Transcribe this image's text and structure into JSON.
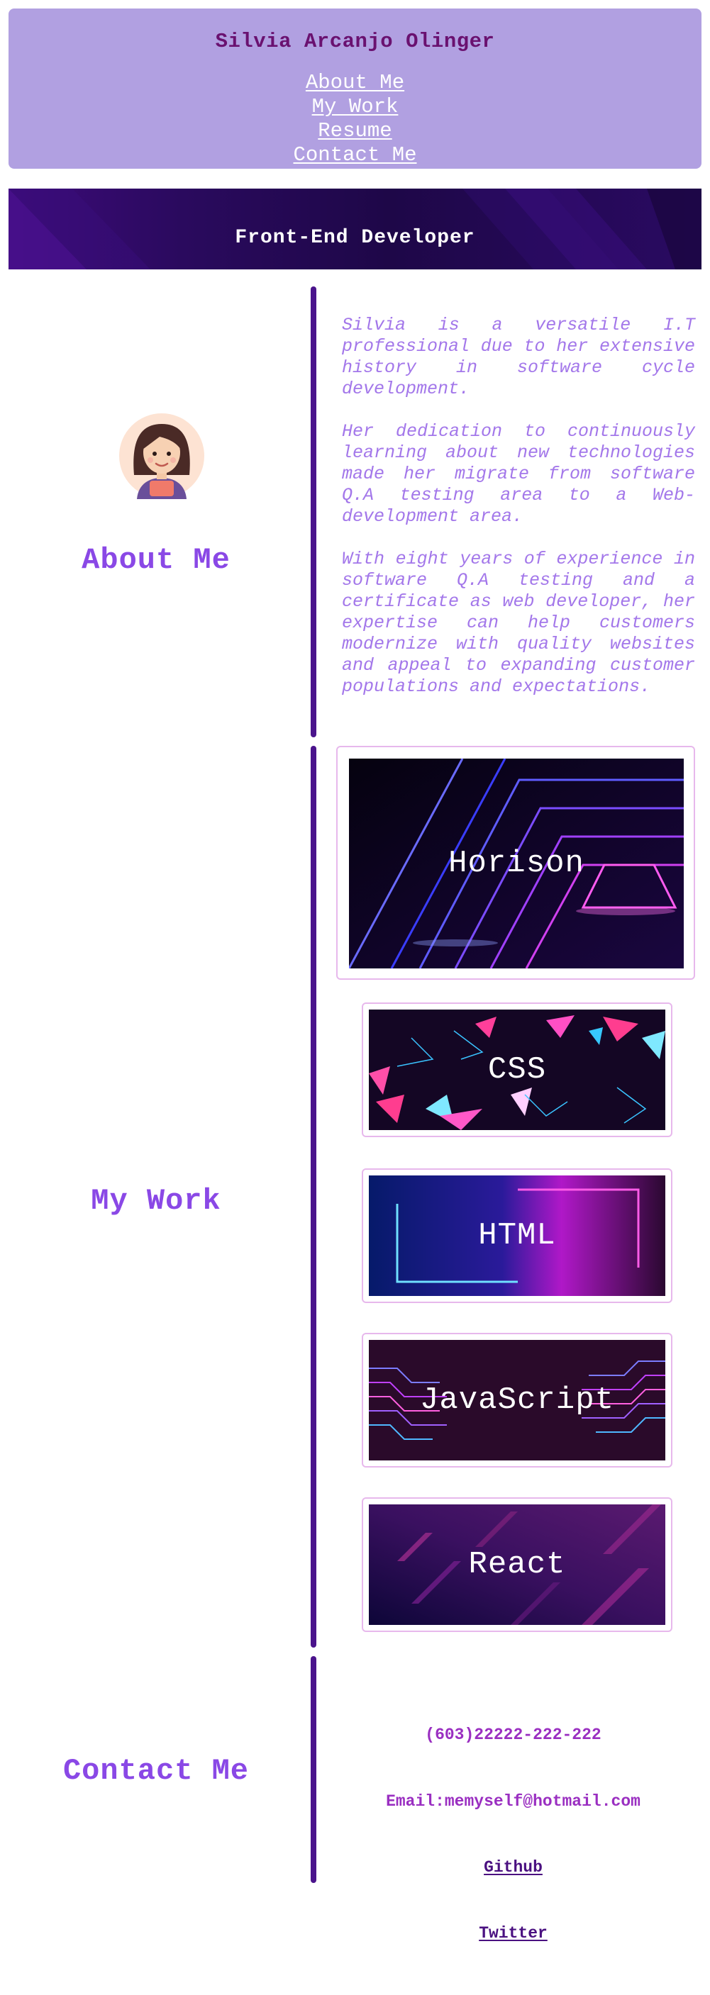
{
  "header": {
    "title": "Silvia Arcanjo Olinger",
    "nav": [
      "About Me",
      "My Work",
      "Resume",
      "Contact Me"
    ]
  },
  "hero": {
    "title": "Front-End Developer"
  },
  "about": {
    "heading": "About Me",
    "avatar_icon": "girl-avatar-icon",
    "paragraphs": [
      "Silvia is a versatile I.T professional due to her extensive history in software cycle development.",
      "Her dedication to continuously learning about new technologies made her migrate from software Q.A testing area to a Web-development area.",
      "With eight years of experience in software Q.A testing and a certificate as web developer, her expertise can help customers modernize with quality websites and appeal to expanding customer populations and expectations."
    ]
  },
  "work": {
    "heading": "My Work",
    "projects": [
      "Horison",
      "CSS",
      "HTML",
      "JavaScript",
      "React"
    ]
  },
  "contact": {
    "heading": "Contact Me",
    "phone": "(603)22222-222-222",
    "email": "Email:memyself@hotmail.com",
    "github": "Github",
    "twitter": "Twitter"
  },
  "colors": {
    "header_bg": "#b1a0e1",
    "title": "#6a1170",
    "heading": "#8a48e6",
    "divider": "#4b148c",
    "about_text": "#a377ea",
    "card_border": "#e7b8ec"
  }
}
